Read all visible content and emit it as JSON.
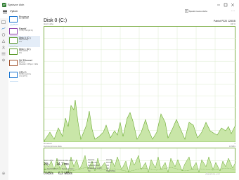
{
  "window": {
    "title": "Správce úloh",
    "minimize_icon": "minimize-icon",
    "maximize_icon": "maximize-icon",
    "close_icon": "close-icon"
  },
  "toolbar": {
    "options_label": "Výkon",
    "run_task_label": "Spustit novou úlohu",
    "more_icon": "more-icon"
  },
  "sidebar": {
    "items": [
      {
        "title": "Procesor",
        "sub": "3%  2,89 GHz",
        "color": "#1a75d0",
        "selected": false
      },
      {
        "title": "Paměť",
        "sub": "7,7/15,7 GB (49 %)",
        "color": "#8e44ad",
        "selected": false
      },
      {
        "title": "Disk 0 (C:)",
        "sub": "SSD (NVMe)",
        "sub2": "2 %",
        "color": "#5c9a2c",
        "selected": true
      },
      {
        "title": "Disk 1 (D:)",
        "sub": "HDD (SATA)",
        "sub2": "0 %",
        "color": "#5c9a2c",
        "selected": false
      },
      {
        "title": "Síť Ethernet",
        "sub": "Ethernet",
        "sub2": "Odesílání: 0  Příjem: 0 kb/s",
        "color": "#a0522d",
        "selected": false
      },
      {
        "title": "GPU 0",
        "sub": "NVIDIA GeForce",
        "sub2": "1 % (43 °C)",
        "color": "#1a75d0",
        "selected": false
      }
    ]
  },
  "main": {
    "title": "Disk 0 (C:)",
    "model": "Patriot P320 128GB",
    "graph1_label_left": "Aktivní doba",
    "graph1_label_right": "100 %",
    "graph1_bottom_left": "60 sekund",
    "graph1_bottom_right": "0",
    "graph2_label_left": "Rychlost přenosu disku",
    "graph2_label_right": "10 MB/s"
  },
  "stats": {
    "active_time_label": "Aktivní doba",
    "active_time_value": "2%",
    "response_label": "Průměrná doba odezvy",
    "response_value": "14,7 ms",
    "read_label": "Rychlost čtení",
    "read_value": "0 kB/s",
    "write_label": "Rychlost zápisu",
    "write_value": "6,2 MB/s",
    "capacity_label": "Kapacita:",
    "capacity_value": "119 GB",
    "formatted_label": "Formátováno:",
    "formatted_value": "119 GB",
    "system_disk_label": "Systémový disk:",
    "system_disk_value": "Ano",
    "page_file_label": "Stránkovací soubor:",
    "page_file_value": "Ano",
    "type_label": "Typ:",
    "type_value": "SSD (NVMe)"
  },
  "watermark": "Bazos.cz"
}
